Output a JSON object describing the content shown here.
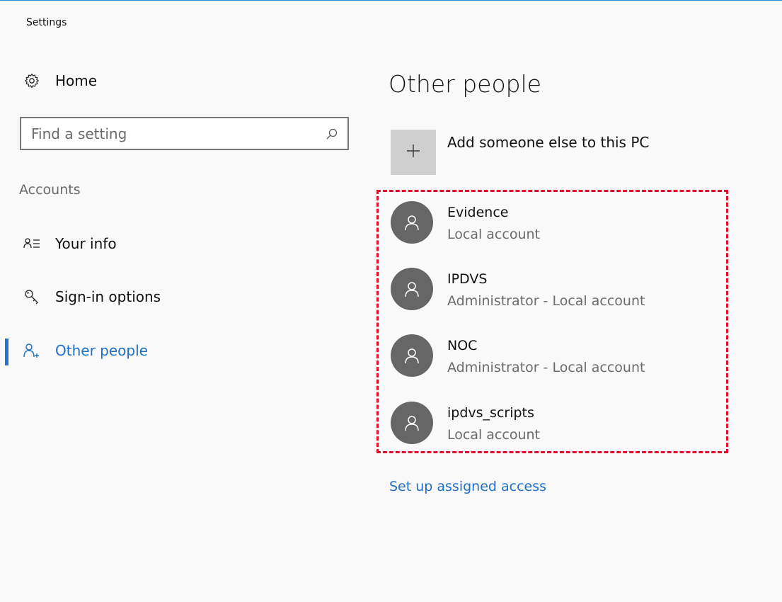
{
  "window": {
    "title": "Settings"
  },
  "sidebar": {
    "home_label": "Home",
    "search": {
      "placeholder": "Find a setting",
      "value": ""
    },
    "section_header": "Accounts",
    "items": [
      {
        "label": "Your info",
        "icon": "contact-info-icon",
        "selected": false
      },
      {
        "label": "Sign-in options",
        "icon": "key-icon",
        "selected": false
      },
      {
        "label": "Other people",
        "icon": "add-person-icon",
        "selected": true
      }
    ]
  },
  "main": {
    "title": "Other people",
    "add_label": "Add someone else to this PC",
    "people": [
      {
        "name": "Evidence",
        "type": "Local account"
      },
      {
        "name": "IPDVS",
        "type": "Administrator - Local account"
      },
      {
        "name": "NOC",
        "type": "Administrator - Local account"
      },
      {
        "name": "ipdvs_scripts",
        "type": "Local account"
      }
    ],
    "link_label": "Set up assigned access"
  },
  "colors": {
    "accent": "#1f6fc4",
    "highlight": "#e0102a",
    "avatar": "#666666",
    "background": "#f9f9f9"
  }
}
